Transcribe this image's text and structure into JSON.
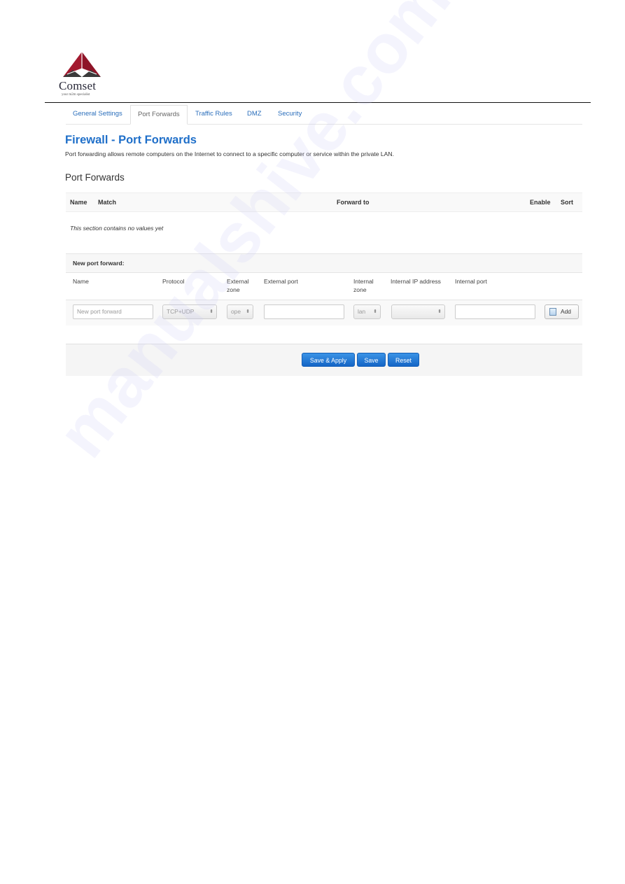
{
  "brand": {
    "name": "Comset",
    "tagline": "your m2m specialist",
    "colors": {
      "logo_red": "#a3192f",
      "logo_dark": "#3a3a3a"
    }
  },
  "tabs": [
    {
      "label": "General Settings",
      "active": false
    },
    {
      "label": "Port Forwards",
      "active": true
    },
    {
      "label": "Traffic Rules",
      "active": false
    },
    {
      "label": "DMZ",
      "active": false
    },
    {
      "label": "Security",
      "active": false
    }
  ],
  "page": {
    "title": "Firewall - Port Forwards",
    "description": "Port forwarding allows remote computers on the Internet to connect to a specific computer or service within the private LAN.",
    "section_title": "Port Forwards"
  },
  "table": {
    "columns": [
      "Name",
      "Match",
      "Forward to",
      "Enable",
      "Sort"
    ],
    "empty_message": "This section contains no values yet"
  },
  "new_forward": {
    "heading": "New port forward:",
    "labels": {
      "name": "Name",
      "protocol": "Protocol",
      "external_zone_1": "External",
      "external_zone_2": "zone",
      "external_port": "External port",
      "internal_zone_1": "Internal",
      "internal_zone_2": "zone",
      "internal_ip": "Internal IP address",
      "internal_port": "Internal port"
    },
    "fields": {
      "name_placeholder": "New port forward",
      "name_value": "",
      "protocol_value": "TCP+UDP",
      "external_zone_value": "ope",
      "external_port_value": "",
      "internal_zone_value": "lan",
      "internal_ip_value": "",
      "internal_port_value": ""
    },
    "add_label": "Add"
  },
  "actions": {
    "save_apply": "Save & Apply",
    "save": "Save",
    "reset": "Reset"
  },
  "watermark": "manualshive.com"
}
